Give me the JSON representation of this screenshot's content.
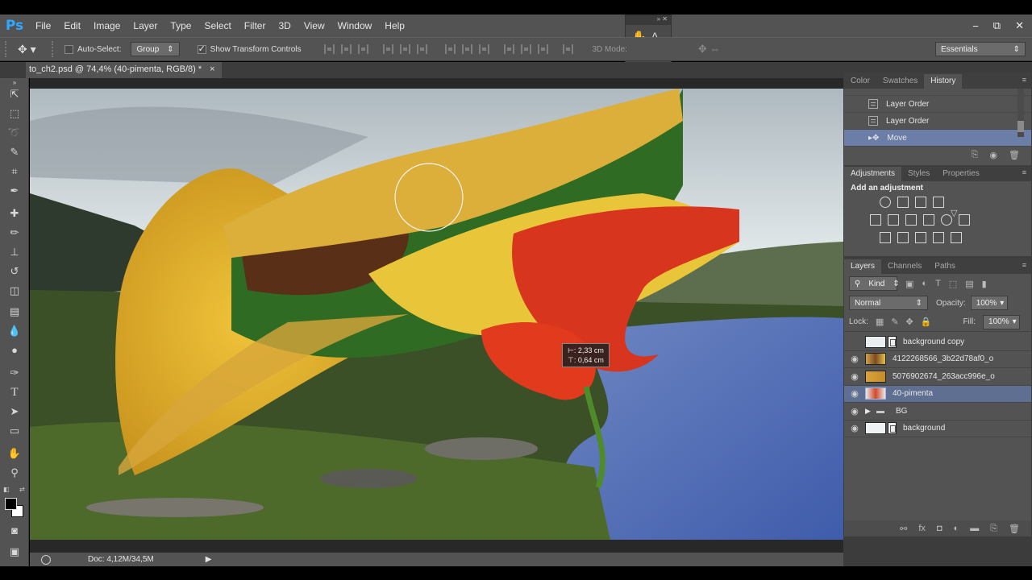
{
  "app": {
    "logo": "Ps"
  },
  "menu": [
    "File",
    "Edit",
    "Image",
    "Layer",
    "Type",
    "Select",
    "Filter",
    "3D",
    "View",
    "Window",
    "Help"
  ],
  "window_controls": {
    "minimize": "−",
    "restore": "⧉",
    "close": "✕"
  },
  "options": {
    "auto_select_label": "Auto-Select:",
    "auto_select_checked": false,
    "group_value": "Group",
    "show_transform_label": "Show Transform Controls",
    "show_transform_checked": true,
    "mode_3d_label": "3D Mode:",
    "workspace": "Essentials"
  },
  "document": {
    "tab_title": "to_ch2.psd @ 74,4% (40-pimenta, RGB/8) *",
    "close": "×",
    "status": "Doc: 4,12M/34,5M",
    "move_tooltip": {
      "dx": "⊢: 2,33 cm",
      "dy": "⊤: 0,64 cm"
    }
  },
  "panels": {
    "top_tabs": [
      "Color",
      "Swatches",
      "History"
    ],
    "history_items": [
      {
        "label": "Layer Order",
        "selected": false
      },
      {
        "label": "Layer Order",
        "selected": false
      },
      {
        "label": "Move",
        "selected": true
      }
    ],
    "adjustments_tabs": [
      "Adjustments",
      "Styles",
      "Properties"
    ],
    "adjustments_title": "Add an adjustment",
    "layers_tabs": [
      "Layers",
      "Channels",
      "Paths"
    ],
    "filter_kind": "Kind",
    "blend_mode": "Normal",
    "opacity_label": "Opacity:",
    "opacity_value": "100%",
    "lock_label": "Lock:",
    "fill_label": "Fill:",
    "fill_value": "100%",
    "layers": [
      {
        "name": "background copy",
        "visible": false,
        "selected": false,
        "kind": "image"
      },
      {
        "name": "4122268566_3b22d78af0_o",
        "visible": true,
        "selected": false,
        "kind": "image"
      },
      {
        "name": "5076902674_263acc996e_o",
        "visible": true,
        "selected": false,
        "kind": "image"
      },
      {
        "name": "40-pimenta",
        "visible": true,
        "selected": true,
        "kind": "image"
      },
      {
        "name": "BG",
        "visible": true,
        "selected": false,
        "kind": "group"
      },
      {
        "name": "background",
        "visible": true,
        "selected": false,
        "kind": "image"
      }
    ]
  },
  "colors": {
    "chrome": "#535353",
    "dark": "#3c3c3c",
    "selection": "#5f6f92",
    "ps_blue": "#31a8ff"
  }
}
